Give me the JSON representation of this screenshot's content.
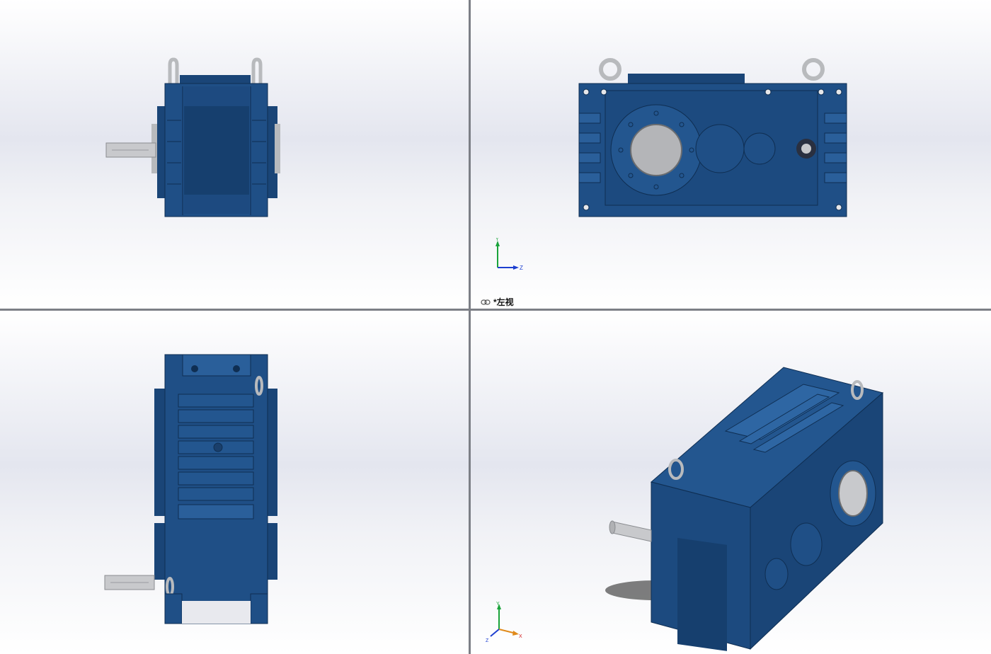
{
  "viewports": {
    "top_left": {
      "name": "front-view"
    },
    "top_right": {
      "name": "left-view",
      "view_label": "*左视",
      "triad": {
        "axis_y": "Y",
        "axis_z": "Z"
      }
    },
    "bottom_left": {
      "name": "top-view"
    },
    "bottom_right": {
      "name": "isometric-view",
      "triad": {
        "axis_y": "Y",
        "axis_x": "X",
        "axis_z": "Z"
      }
    }
  },
  "colors": {
    "body": "#1f4f86",
    "body_dark": "#143a66",
    "body_light": "#2e66a3",
    "steel": "#c8c9cc",
    "divider": "#7c7f86",
    "axis_y": "#1aa33a",
    "axis_z": "#1d3fd0",
    "axis_x": "#d01d1d",
    "axis_iso": "#e08a1a"
  }
}
